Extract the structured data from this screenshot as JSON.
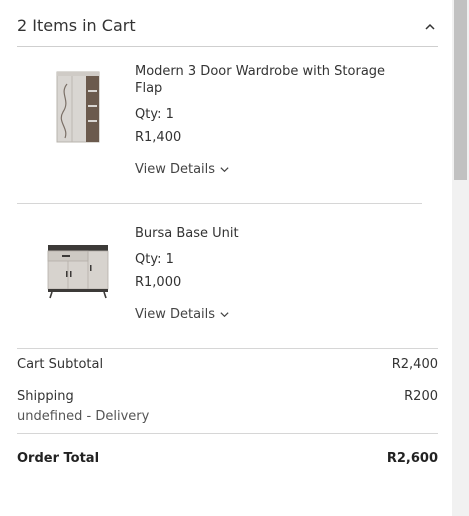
{
  "cart": {
    "header_title": "2 Items in Cart",
    "items": [
      {
        "name": "Modern 3 Door Wardrobe with Storage Flap",
        "qty": "Qty: 1",
        "price": "R1,400",
        "view_details": "View Details"
      },
      {
        "name": "Bursa Base Unit",
        "qty": "Qty: 1",
        "price": "R1,000",
        "view_details": "View Details"
      }
    ]
  },
  "summary": {
    "subtotal_label": "Cart Subtotal",
    "subtotal_value": "R2,400",
    "shipping_label": "Shipping",
    "shipping_value": "R200",
    "shipping_method": "undefined - Delivery",
    "total_label": "Order Total",
    "total_value": "R2,600"
  }
}
